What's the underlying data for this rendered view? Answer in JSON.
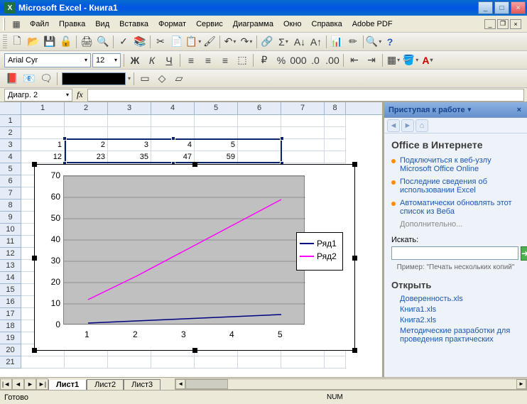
{
  "app": {
    "title": "Microsoft Excel - Книга1",
    "icon_letter": "X"
  },
  "menu": {
    "file": "Файл",
    "edit": "Правка",
    "view": "Вид",
    "insert": "Вставка",
    "format": "Формат",
    "tools": "Сервис",
    "chart": "Диаграмма",
    "window": "Окно",
    "help": "Справка",
    "adobe": "Adobe PDF"
  },
  "font": {
    "name": "Arial Cyr",
    "size": "12",
    "bold": "Ж",
    "italic": "К",
    "underline": "Ч"
  },
  "namebox": "Диагр. 2",
  "fx_label": "fx",
  "columns": [
    "1",
    "2",
    "3",
    "4",
    "5",
    "6",
    "7",
    "8"
  ],
  "cells": {
    "r3": [
      "1",
      "2",
      "3",
      "4",
      "5"
    ],
    "r4": [
      "12",
      "23",
      "35",
      "47",
      "59"
    ]
  },
  "chart_data": {
    "type": "line",
    "categories": [
      "1",
      "2",
      "3",
      "4",
      "5"
    ],
    "series": [
      {
        "name": "Ряд1",
        "values": [
          1,
          2,
          3,
          4,
          5
        ],
        "color": "#000080"
      },
      {
        "name": "Ряд2",
        "values": [
          12,
          23,
          35,
          47,
          59
        ],
        "color": "#ff00ff"
      }
    ],
    "ylim": [
      0,
      70
    ],
    "yticks": [
      0,
      10,
      20,
      30,
      40,
      50,
      60,
      70
    ],
    "xlabel": "",
    "ylabel": "",
    "title": ""
  },
  "taskpane": {
    "title": "Приступая к работе",
    "section1_title": "Office в Интернете",
    "links": [
      "Подключиться к веб-узлу Microsoft Office Online",
      "Последние сведения об использовании Excel",
      "Автоматически обновлять этот список из Веба"
    ],
    "more": "Дополнительно...",
    "search_label": "Искать:",
    "search_placeholder": "",
    "example": "Пример: \"Печать нескольких копий\"",
    "open_title": "Открыть",
    "recent": [
      "Доверенность.xls",
      "Книга1.xls",
      "Книга2.xls",
      "Методические разработки для проведения практических"
    ]
  },
  "sheets": {
    "s1": "Лист1",
    "s2": "Лист2",
    "s3": "Лист3"
  },
  "status": {
    "ready": "Готово",
    "num": "NUM"
  }
}
